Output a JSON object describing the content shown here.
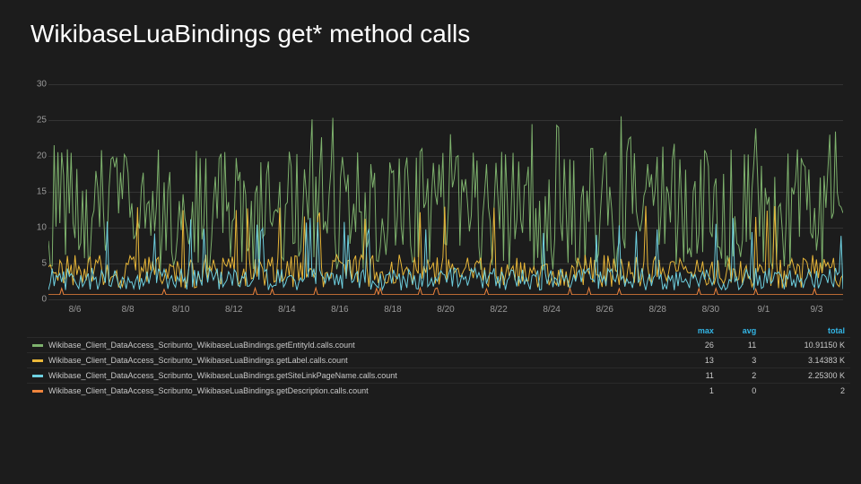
{
  "title": "WikibaseLuaBindings get* method calls",
  "chart_data": {
    "type": "line",
    "xlabel": "",
    "ylabel": "",
    "ylim": [
      0,
      30
    ],
    "y_ticks": [
      0,
      5,
      10,
      15,
      20,
      25,
      30
    ],
    "x_ticks": [
      "8/6",
      "8/8",
      "8/10",
      "8/12",
      "8/14",
      "8/16",
      "8/18",
      "8/20",
      "8/22",
      "8/24",
      "8/26",
      "8/28",
      "8/30",
      "9/1",
      "9/3"
    ],
    "x_range": [
      "8/5",
      "8/4"
    ],
    "series": [
      {
        "name": "Wikibase_Client_DataAccess_Scribunto_WikibaseLuaBindings.getEntityId.calls.count",
        "color": "#7eb26d",
        "max": 26,
        "avg": 11,
        "total": "10.91150 K"
      },
      {
        "name": "Wikibase_Client_DataAccess_Scribunto_WikibaseLuaBindings.getLabel.calls.count",
        "color": "#eab839",
        "max": 13,
        "avg": 3,
        "total": "3.14383 K"
      },
      {
        "name": "Wikibase_Client_DataAccess_Scribunto_WikibaseLuaBindings.getSiteLinkPageName.calls.count",
        "color": "#6ed0e0",
        "max": 11,
        "avg": 2,
        "total": "2.25300 K"
      },
      {
        "name": "Wikibase_Client_DataAccess_Scribunto_WikibaseLuaBindings.getDescription.calls.count",
        "color": "#ef843c",
        "max": 1,
        "avg": 0,
        "total": "2"
      }
    ],
    "legend_headers": {
      "name": "",
      "max": "max",
      "avg": "avg",
      "total": "total"
    }
  }
}
